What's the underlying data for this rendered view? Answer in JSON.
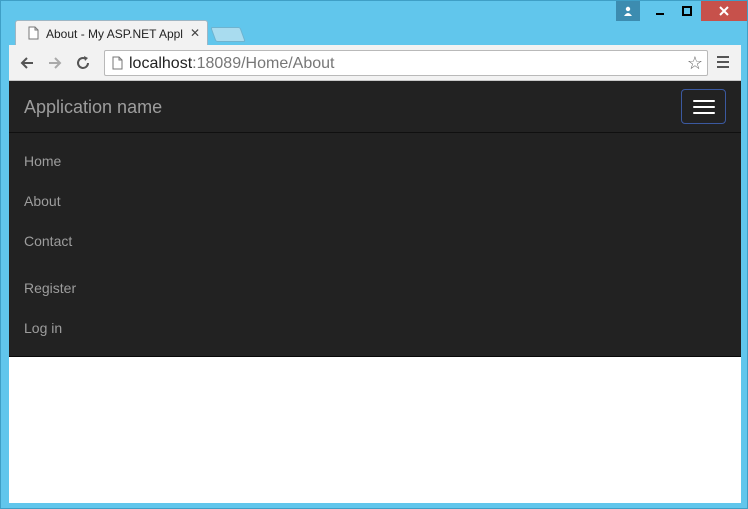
{
  "browser": {
    "tab_title": "About - My ASP.NET Appl",
    "url_host": "localhost",
    "url_path": ":18089/Home/About"
  },
  "page": {
    "brand": "Application name",
    "nav_items": [
      "Home",
      "About",
      "Contact"
    ],
    "account_items": [
      "Register",
      "Log in"
    ]
  },
  "colors": {
    "navbar_bg": "#222222",
    "nav_link": "#9d9d9d",
    "window_frame": "#61c6ec",
    "close_button": "#c7514b"
  }
}
